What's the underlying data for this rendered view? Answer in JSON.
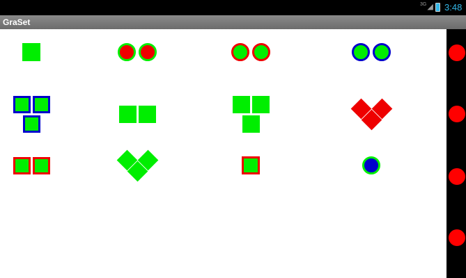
{
  "status_bar": {
    "network": "3G",
    "time": "3:48",
    "battery_color": "#33b5e5"
  },
  "app": {
    "title": "GraSet"
  },
  "colors": {
    "green": "#00ee00",
    "red": "#ee0000",
    "blue": "#0000cc",
    "rail_dot": "#ff0000"
  },
  "right_rail": {
    "dot_count": 4
  },
  "grid": {
    "rows": [
      {
        "row": 1,
        "cards": [
          {
            "pattern": "single-square",
            "fill": "green",
            "outline": "none"
          },
          {
            "pattern": "two-circles",
            "fill": "red",
            "outline": "green"
          },
          {
            "pattern": "two-circles",
            "fill": "green",
            "outline": "red"
          },
          {
            "pattern": "two-circles",
            "fill": "green",
            "outline": "blue"
          }
        ]
      },
      {
        "row": 2,
        "cards": [
          {
            "pattern": "three-squares-triangle",
            "fill": "green",
            "outline": "blue"
          },
          {
            "pattern": "two-squares",
            "fill": "green",
            "outline": "none"
          },
          {
            "pattern": "three-squares-triangle",
            "fill": "green",
            "outline": "none"
          },
          {
            "pattern": "three-diamonds",
            "fill": "red",
            "outline": "none"
          }
        ]
      },
      {
        "row": 3,
        "cards": [
          {
            "pattern": "two-squares",
            "fill": "green",
            "outline": "red"
          },
          {
            "pattern": "three-diamonds",
            "fill": "green",
            "outline": "none"
          },
          {
            "pattern": "single-square",
            "fill": "green",
            "outline": "red"
          },
          {
            "pattern": "single-circle",
            "fill": "blue",
            "outline": "green"
          }
        ]
      }
    ]
  }
}
